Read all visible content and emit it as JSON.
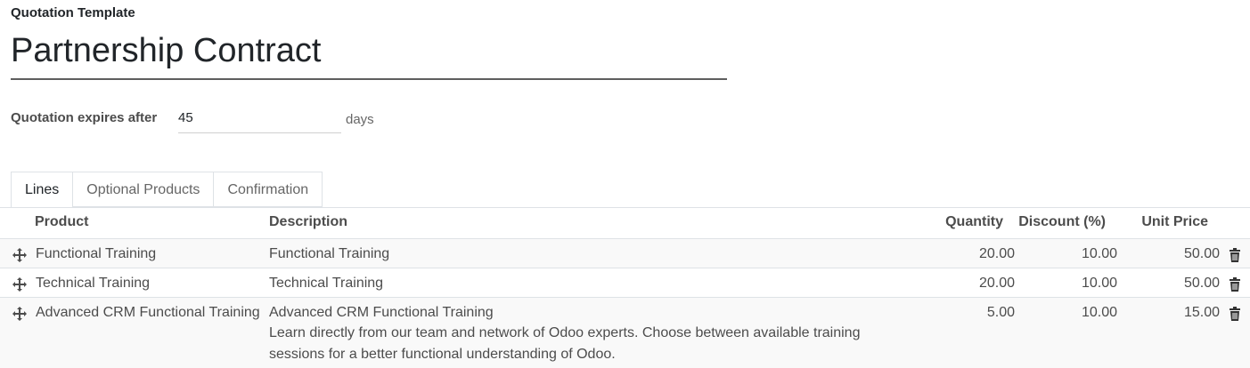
{
  "form": {
    "label": "Quotation Template",
    "name": "Partnership Contract",
    "expires_label": "Quotation expires after",
    "expires_value": "45",
    "expires_unit": "days"
  },
  "tabs": [
    {
      "label": "Lines",
      "active": true
    },
    {
      "label": "Optional Products",
      "active": false
    },
    {
      "label": "Confirmation",
      "active": false
    }
  ],
  "table": {
    "headers": {
      "product": "Product",
      "description": "Description",
      "quantity": "Quantity",
      "discount": "Discount (%)",
      "unit_price": "Unit Price"
    },
    "rows": [
      {
        "product": "Functional Training",
        "description": "Functional Training",
        "quantity": "20.00",
        "discount": "10.00",
        "unit_price": "50.00"
      },
      {
        "product": "Technical Training",
        "description": "Technical Training",
        "quantity": "20.00",
        "discount": "10.00",
        "unit_price": "50.00"
      },
      {
        "product": "Advanced CRM Functional Training",
        "description": "Advanced CRM Functional Training",
        "description_line2": "Learn directly from our team and network of Odoo experts. Choose between available training",
        "description_line3": "sessions for a better functional understanding of Odoo.",
        "quantity": "5.00",
        "discount": "10.00",
        "unit_price": "15.00"
      }
    ]
  },
  "icons": {
    "drag": "drag-handle-icon",
    "delete": "trash-icon"
  }
}
